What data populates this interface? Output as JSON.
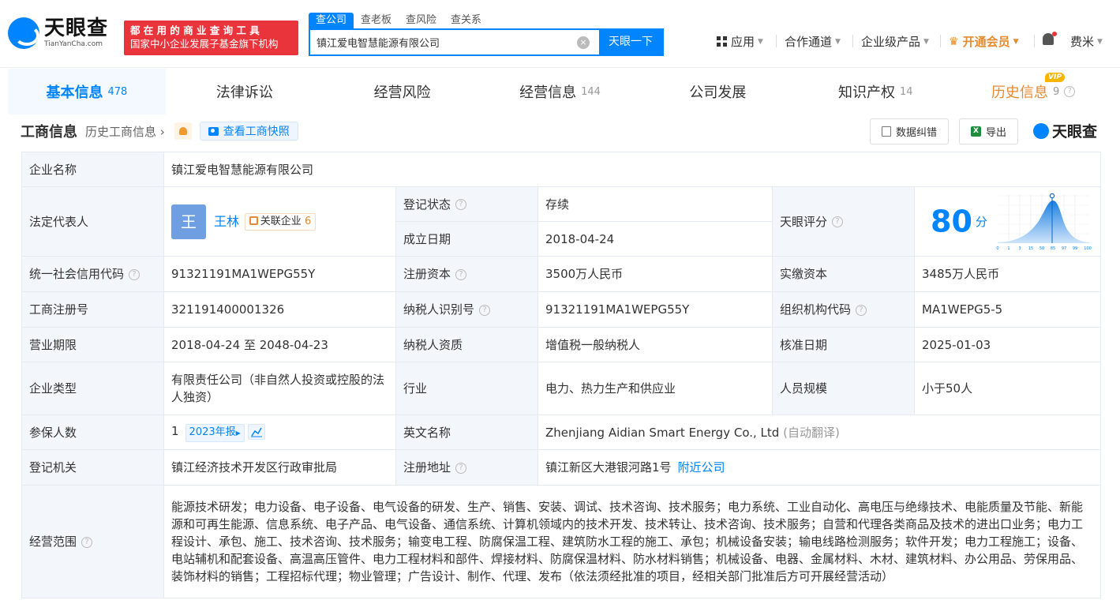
{
  "header": {
    "logo_cn": "天眼查",
    "logo_en": "TianYanCha.com",
    "slogan_line1": "都在用的商业查询工具",
    "slogan_line2": "国家中小企业发展子基金旗下机构",
    "search_tabs": [
      "查公司",
      "查老板",
      "查风险",
      "查关系"
    ],
    "search_value": "镇江爱电智慧能源有限公司",
    "search_button": "天眼一下",
    "clear_icon": "×",
    "nav": {
      "apps": "应用",
      "partner": "合作通道",
      "enterprise": "企业级产品",
      "vip": "开通会员",
      "user": "费米"
    }
  },
  "tabs": [
    {
      "label": "基本信息",
      "count": "478"
    },
    {
      "label": "法律诉讼",
      "count": ""
    },
    {
      "label": "经营风险",
      "count": ""
    },
    {
      "label": "经营信息",
      "count": "144"
    },
    {
      "label": "公司发展",
      "count": ""
    },
    {
      "label": "知识产权",
      "count": "14"
    },
    {
      "label": "历史信息",
      "count": "9"
    }
  ],
  "vip_badge": "VIP",
  "subheader": {
    "title": "工商信息",
    "history": "历史工商信息",
    "snapshot": "查看工商快照",
    "correct_btn": "数据纠错",
    "export_btn": "导出",
    "brand": "天眼查"
  },
  "info": {
    "company_name_label": "企业名称",
    "company_name": "镇江爱电智慧能源有限公司",
    "legal_rep_label": "法定代表人",
    "legal_rep_avatar": "王",
    "legal_rep_name": "王林",
    "related_label": "关联企业",
    "related_count": "6",
    "reg_status_label": "登记状态",
    "reg_status": "存续",
    "found_date_label": "成立日期",
    "found_date": "2018-04-24",
    "score_label": "天眼评分",
    "score": "80",
    "score_unit": "分",
    "score_axis": [
      "0",
      "1",
      "3",
      "15",
      "50",
      "85",
      "97",
      "99",
      "100"
    ],
    "credit_code_label": "统一社会信用代码",
    "credit_code": "91321191MA1WEPG55Y",
    "reg_capital_label": "注册资本",
    "reg_capital": "3500万人民币",
    "paid_capital_label": "实缴资本",
    "paid_capital": "3485万人民币",
    "reg_no_label": "工商注册号",
    "reg_no": "321191400001326",
    "taxpayer_id_label": "纳税人识别号",
    "taxpayer_id": "91321191MA1WEPG55Y",
    "org_code_label": "组织机构代码",
    "org_code": "MA1WEPG5-5",
    "term_label": "营业期限",
    "term": "2018-04-24 至 2048-04-23",
    "tax_qual_label": "纳税人资质",
    "tax_qual": "增值税一般纳税人",
    "approve_date_label": "核准日期",
    "approve_date": "2025-01-03",
    "type_label": "企业类型",
    "type": "有限责任公司（非自然人投资或控股的法人独资）",
    "industry_label": "行业",
    "industry": "电力、热力生产和供应业",
    "staff_label": "人员规模",
    "staff": "小于50人",
    "insured_label": "参保人数",
    "insured": "1",
    "insured_year": "2023年报",
    "en_name_label": "英文名称",
    "en_name": "Zhenjiang Aidian Smart Energy Co., Ltd",
    "en_name_note": "(自动翻译)",
    "authority_label": "登记机关",
    "authority": "镇江经济技术开发区行政审批局",
    "address_label": "注册地址",
    "address": "镇江新区大港银河路1号",
    "nearby": "附近公司",
    "scope_label": "经营范围",
    "scope": "能源技术研发；电力设备、电子设备、电气设备的研发、生产、销售、安装、调试、技术咨询、技术服务；电力系统、工业自动化、高电压与绝缘技术、电能质量及节能、新能源和可再生能源、信息系统、电子产品、电气设备、通信系统、计算机领域内的技术开发、技术转让、技术咨询、技术服务；自营和代理各类商品及技术的进出口业务；电力工程设计、承包、施工、技术咨询、技术服务；输变电工程、防腐保温工程、建筑防水工程的施工、承包；机械设备安装；输电线路检测服务；软件开发；电力工程施工；设备、电站辅机和配套设备、高温高压管件、电力工程材料和部件、焊接材料、防腐保温材料、防水材料销售；机械设备、电器、金属材料、木材、建筑材料、办公用品、劳保用品、装饰材料的销售；工程招标代理；物业管理；广告设计、制作、代理、发布（依法须经批准的项目，经相关部门批准后方可开展经营活动）"
  },
  "colors": {
    "brand": "#0084ff",
    "slogan_bg": "#e9343b",
    "status_green": "#2ab37a",
    "vip_orange": "#e58a2f"
  }
}
